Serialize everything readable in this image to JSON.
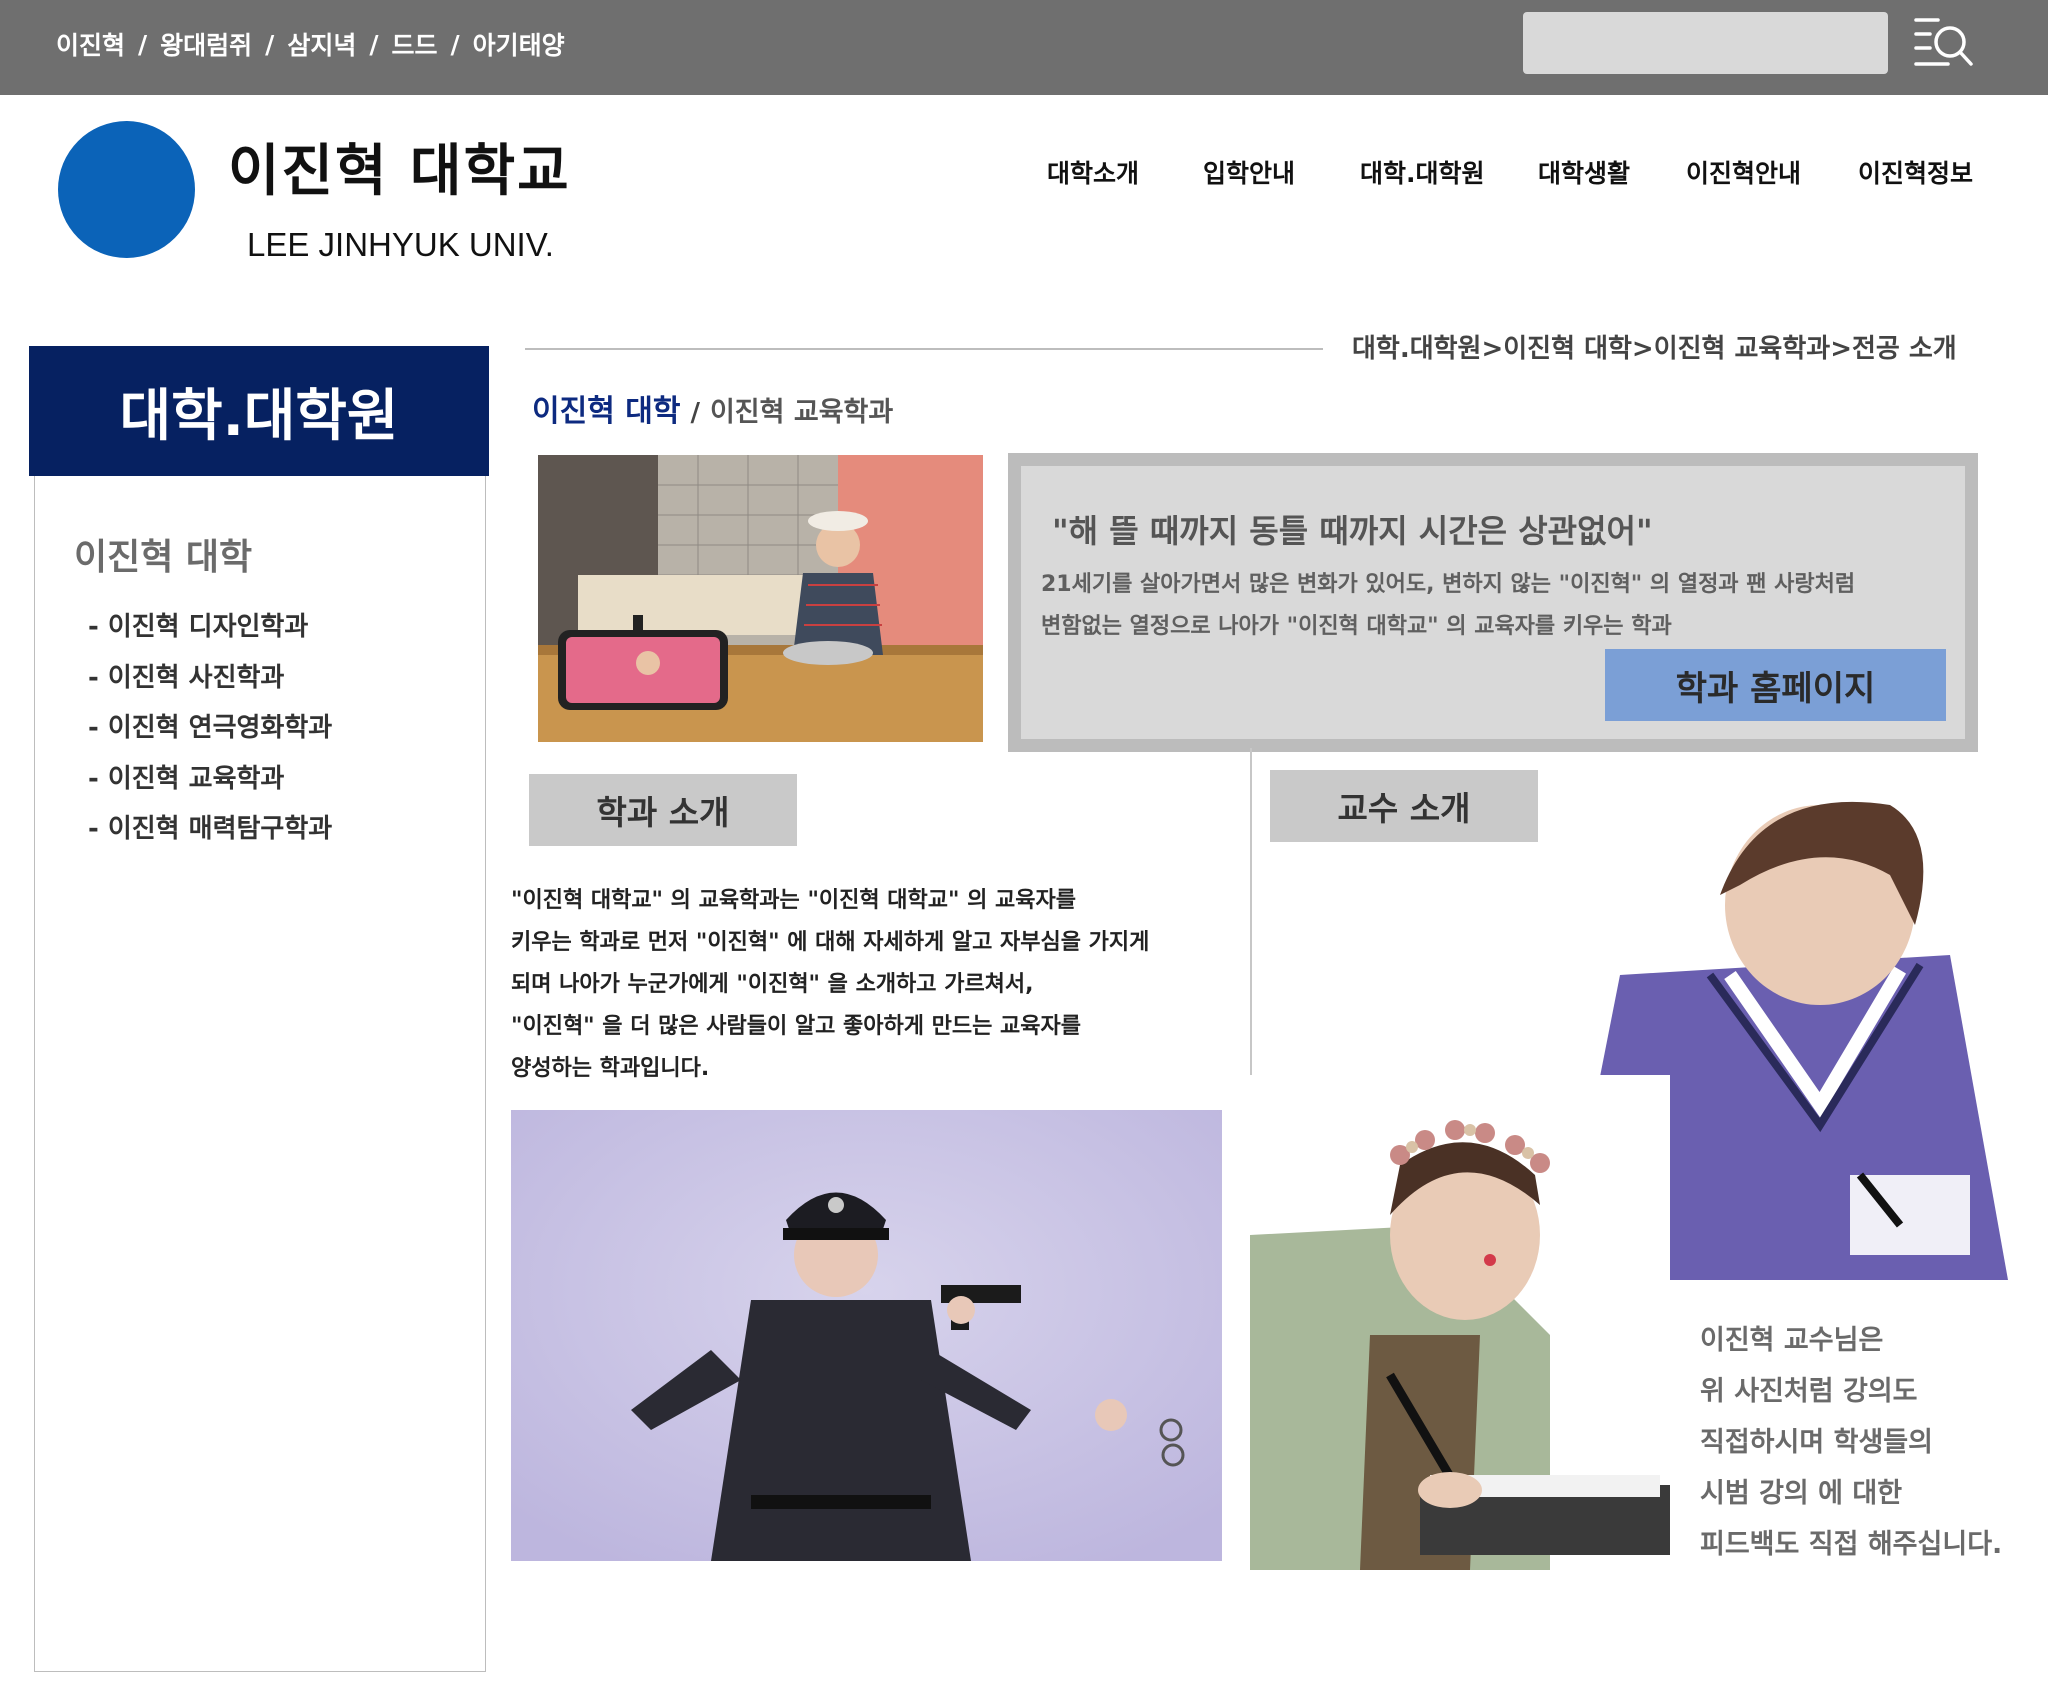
{
  "topbar": {
    "links": [
      "이진혁",
      "왕대럼쥐",
      "삼지녁",
      "드드",
      "아기태양"
    ],
    "search_placeholder": ""
  },
  "header": {
    "name_kr": "이진혁 대학교",
    "name_en": "LEE JINHYUK UNIV.",
    "nav": [
      "대학소개",
      "입학안내",
      "대학.대학원",
      "대학생활",
      "이진혁안내",
      "이진혁정보"
    ]
  },
  "sidebar": {
    "heading": "대학.대학원",
    "group_title": "이진혁 대학",
    "items": [
      "- 이진혁 디자인학과",
      "- 이진혁 사진학과",
      "- 이진혁 연극영화학과",
      "- 이진혁 교육학과",
      "- 이진혁 매력탐구학과"
    ]
  },
  "breadcrumb": "대학.대학원>이진혁 대학>이진혁 교육학과>전공 소개",
  "section": {
    "college": "이진혁 대학",
    "separator": "/",
    "dept": "이진혁 교육학과"
  },
  "quote": {
    "title": "\"해 뜰 때까지 동틀 때까지 시간은 상관없어\"",
    "line1": "21세기를 살아가면서 많은 변화가 있어도, 변하지 않는  \"이진혁\" 의 열정과 팬 사랑처럼",
    "line2": "변함없는 열정으로 나아가  \"이진혁 대학교\" 의 교육자를 키우는 학과",
    "button": "학과 홈페이지"
  },
  "intro": {
    "label": "학과 소개",
    "lines": [
      " \"이진혁 대학교\" 의 교육학과는  \"이진혁 대학교\" 의 교육자를",
      "키우는 학과로 먼저  \"이진혁\" 에 대해 자세하게 알고 자부심을 가지게",
      "되며 나아가 누군가에게  \"이진혁\" 을 소개하고 가르쳐서,",
      " \"이진혁\" 을 더 많은 사람들이 알고 좋아하게 만드는 교육자를",
      "양성하는 학과입니다."
    ]
  },
  "professor": {
    "label": "교수 소개",
    "lines": [
      "이진혁 교수님은",
      " 위 사진처럼 강의도",
      "직접하시며 학생들의",
      "시범 강의 에 대한",
      "피드백도 직접 해주십니다."
    ]
  },
  "colors": {
    "topbar": "#6f6f6f",
    "logo": "#0b63b8",
    "sidebar_head": "#062161",
    "college_text": "#0d2a80",
    "button": "#7b9fd6",
    "tab": "#c9c9c9"
  },
  "icons": {
    "menu_search": "menu-search-icon"
  }
}
